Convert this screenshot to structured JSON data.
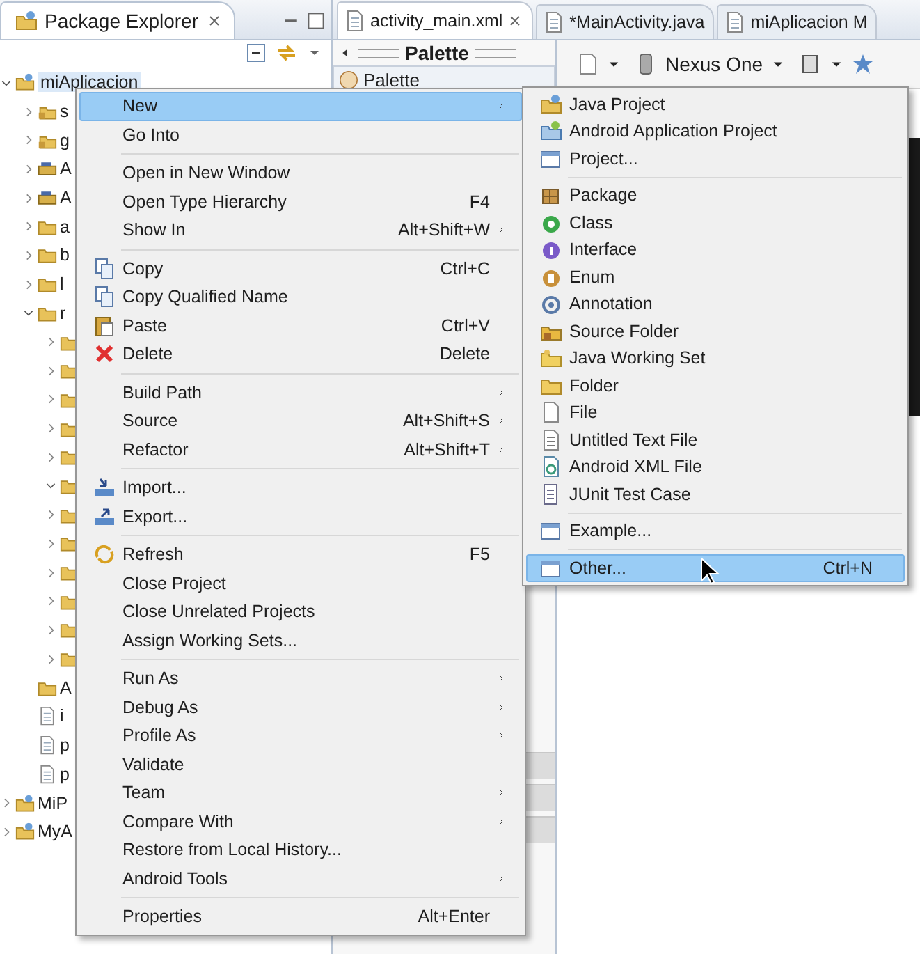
{
  "package_explorer": {
    "title": "Package Explorer",
    "tree": [
      {
        "label": "miAplicacion",
        "expanded": true,
        "children": [
          {
            "label": "s",
            "expanded": false
          },
          {
            "label": "g",
            "expanded": false
          },
          {
            "label": "A",
            "expanded": false
          },
          {
            "label": "A",
            "expanded": false
          },
          {
            "label": "a",
            "expanded": false
          },
          {
            "label": "b",
            "expanded": false
          },
          {
            "label": "l",
            "expanded": false
          },
          {
            "label": "r",
            "expanded": true,
            "children": [
              {
                "expanded": false
              },
              {
                "expanded": false
              },
              {
                "expanded": false
              },
              {
                "expanded": false
              },
              {
                "expanded": false
              },
              {
                "expanded": true
              },
              {
                "expanded": false
              },
              {
                "expanded": false
              },
              {
                "expanded": false
              },
              {
                "expanded": false
              },
              {
                "expanded": false
              },
              {
                "expanded": false
              }
            ]
          },
          {
            "label": "A"
          },
          {
            "label": "i"
          },
          {
            "label": "p"
          },
          {
            "label": "p"
          }
        ]
      },
      {
        "label": "MiP",
        "expanded": false
      },
      {
        "label": "MyA",
        "expanded": false
      }
    ]
  },
  "editor": {
    "tabs": [
      {
        "label": "activity_main.xml",
        "selected": true
      },
      {
        "label": "*MainActivity.java",
        "selected": false
      },
      {
        "label": "miAplicacion M",
        "selected": false
      }
    ],
    "palette": {
      "title": "Palette",
      "item": "Palette"
    },
    "device": "Nexus One"
  },
  "context_menu": [
    {
      "kind": "item",
      "label": "New",
      "selected": true,
      "submenu": true
    },
    {
      "kind": "item",
      "label": "Go Into",
      "selected": false
    },
    {
      "kind": "separator"
    },
    {
      "kind": "item",
      "label": "Open in New Window",
      "selected": false
    },
    {
      "kind": "item",
      "label": "Open Type Hierarchy",
      "shortcut": "F4",
      "selected": false
    },
    {
      "kind": "item",
      "label": "Show In",
      "shortcut": "Alt+Shift+W",
      "selected": false,
      "submenu": true
    },
    {
      "kind": "separator"
    },
    {
      "kind": "item",
      "label": "Copy",
      "shortcut": "Ctrl+C",
      "selected": false
    },
    {
      "kind": "item",
      "label": "Copy Qualified Name",
      "selected": false
    },
    {
      "kind": "item",
      "label": "Paste",
      "shortcut": "Ctrl+V",
      "selected": false
    },
    {
      "kind": "item",
      "label": "Delete",
      "shortcut": "Delete",
      "selected": false
    },
    {
      "kind": "separator"
    },
    {
      "kind": "item",
      "label": "Build Path",
      "selected": false,
      "submenu": true
    },
    {
      "kind": "item",
      "label": "Source",
      "shortcut": "Alt+Shift+S",
      "selected": false,
      "submenu": true
    },
    {
      "kind": "item",
      "label": "Refactor",
      "shortcut": "Alt+Shift+T",
      "selected": false,
      "submenu": true
    },
    {
      "kind": "separator"
    },
    {
      "kind": "item",
      "label": "Import...",
      "selected": false
    },
    {
      "kind": "item",
      "label": "Export...",
      "selected": false
    },
    {
      "kind": "separator"
    },
    {
      "kind": "item",
      "label": "Refresh",
      "shortcut": "F5",
      "selected": false
    },
    {
      "kind": "item",
      "label": "Close Project",
      "selected": false
    },
    {
      "kind": "item",
      "label": "Close Unrelated Projects",
      "selected": false
    },
    {
      "kind": "item",
      "label": "Assign Working Sets...",
      "selected": false
    },
    {
      "kind": "separator"
    },
    {
      "kind": "item",
      "label": "Run As",
      "selected": false,
      "submenu": true
    },
    {
      "kind": "item",
      "label": "Debug As",
      "selected": false,
      "submenu": true
    },
    {
      "kind": "item",
      "label": "Profile As",
      "selected": false,
      "submenu": true
    },
    {
      "kind": "item",
      "label": "Validate",
      "selected": false
    },
    {
      "kind": "item",
      "label": "Team",
      "selected": false,
      "submenu": true
    },
    {
      "kind": "item",
      "label": "Compare With",
      "selected": false,
      "submenu": true
    },
    {
      "kind": "item",
      "label": "Restore from Local History...",
      "selected": false
    },
    {
      "kind": "item",
      "label": "Android Tools",
      "selected": false,
      "submenu": true
    },
    {
      "kind": "separator"
    },
    {
      "kind": "item",
      "label": "Properties",
      "shortcut": "Alt+Enter",
      "selected": false
    }
  ],
  "new_submenu": [
    {
      "kind": "item",
      "label": "Java Project",
      "selected": false
    },
    {
      "kind": "item",
      "label": "Android Application Project",
      "selected": false
    },
    {
      "kind": "item",
      "label": "Project...",
      "selected": false
    },
    {
      "kind": "separator"
    },
    {
      "kind": "item",
      "label": "Package",
      "selected": false
    },
    {
      "kind": "item",
      "label": "Class",
      "selected": false
    },
    {
      "kind": "item",
      "label": "Interface",
      "selected": false
    },
    {
      "kind": "item",
      "label": "Enum",
      "selected": false
    },
    {
      "kind": "item",
      "label": "Annotation",
      "selected": false
    },
    {
      "kind": "item",
      "label": "Source Folder",
      "selected": false
    },
    {
      "kind": "item",
      "label": "Java Working Set",
      "selected": false
    },
    {
      "kind": "item",
      "label": "Folder",
      "selected": false
    },
    {
      "kind": "item",
      "label": "File",
      "selected": false
    },
    {
      "kind": "item",
      "label": "Untitled Text File",
      "selected": false
    },
    {
      "kind": "item",
      "label": "Android XML File",
      "selected": false
    },
    {
      "kind": "item",
      "label": "JUnit Test Case",
      "selected": false
    },
    {
      "kind": "separator"
    },
    {
      "kind": "item",
      "label": "Example...",
      "selected": false
    },
    {
      "kind": "separator"
    },
    {
      "kind": "item",
      "label": "Other...",
      "shortcut": "Ctrl+N",
      "selected": true
    }
  ]
}
